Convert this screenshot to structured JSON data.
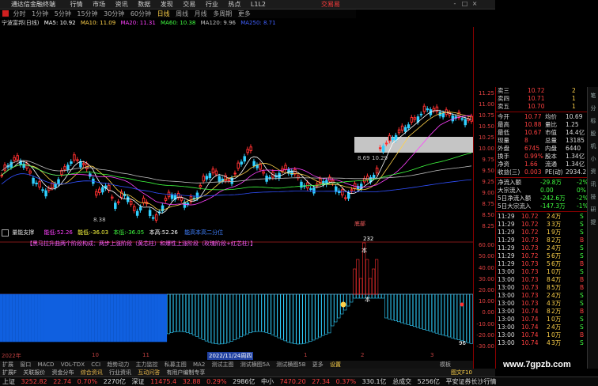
{
  "app": {
    "title": "通达信金融终端",
    "menu": [
      "行情",
      "市场",
      "资讯",
      "数据",
      "发现",
      "交易",
      "行业",
      "热点",
      "L1L2"
    ],
    "broker": "交易易",
    "window_buttons": [
      "-",
      "□",
      "×"
    ]
  },
  "periods": [
    "分时",
    "1分钟",
    "5分钟",
    "15分钟",
    "30分钟",
    "60分钟",
    "日线",
    "周线",
    "月线",
    "多周期",
    "更多"
  ],
  "active_period": "日线",
  "ma_legend": {
    "stock": "宁波富邦(日线)",
    "items": [
      {
        "label": "MA5: 10.92",
        "color": "#ffffff"
      },
      {
        "label": "MA10: 11.09",
        "color": "#ffd24a"
      },
      {
        "label": "MA20: 11.31",
        "color": "#ff40ff"
      },
      {
        "label": "MA60: 10.38",
        "color": "#40ff40"
      },
      {
        "label": "MA120: 9.96",
        "color": "#c0c0c0"
      },
      {
        "label": "MA250: 8.71",
        "color": "#4060ff"
      }
    ]
  },
  "chart_labels": {
    "low_mark": "8.38",
    "mid_mark": "8.69",
    "mid_mark2": "10.29",
    "ind_badge": "232",
    "ind_ben1": "本",
    "ind_ben2": "本",
    "ind_low": "96",
    "bottom_label": "底部"
  },
  "price_axis": [
    "11.25",
    "11.00",
    "10.75",
    "10.50",
    "10.25",
    "10.00",
    "9.75",
    "9.50",
    "9.25",
    "9.00",
    "8.75",
    "8.50",
    "8.25"
  ],
  "ind_axis": [
    "60.00",
    "50.00",
    "40.00",
    "30.00",
    "20.00",
    "10.00",
    "0.00",
    "-10.00",
    "-20.00",
    "-30.00"
  ],
  "indicator": {
    "name": "量能支撑",
    "values": [
      {
        "label": "能低:52.26",
        "color": "#ff40ff"
      },
      {
        "label": "能低:-36.03",
        "color": "#ffff40"
      },
      {
        "label": "本低:-36.05",
        "color": "#40ff40"
      },
      {
        "label": "本高:52.26",
        "color": "#ffffff"
      },
      {
        "label": "能高本高二分位",
        "color": "#4080ff"
      }
    ],
    "banner": "【黑马拉升曲两个阶段构成：两步上涨阶段（黄芯柱）和爆性上涨阶段（玫瑰阶段+红芯柱）】"
  },
  "dates": {
    "d1": "2022年",
    "d2": "10",
    "d3": "11",
    "d4": "2022/11/24周四",
    "d5": "1",
    "d6": "2",
    "d7": "3"
  },
  "tabs": [
    "扩展",
    "窗口",
    "MACD",
    "VOL-TDX",
    "CCI",
    "趋势动力",
    "主力监控",
    "私募主图",
    "MA2",
    "测试主图",
    "测试横图5A",
    "测试横图5B",
    "更多",
    "设置"
  ],
  "tabs_right": "模板",
  "func_tabs": [
    "扩展F",
    "关联报价",
    "资金分布",
    "综合资讯",
    "行业资讯",
    "互动问答",
    "有用户编制专享"
  ],
  "func_tabs_right": "图文F10",
  "quote": {
    "sell": [
      {
        "label": "卖三",
        "price": "10.72",
        "vol": "2"
      },
      {
        "label": "卖四",
        "price": "10.71",
        "vol": "1"
      },
      {
        "label": "卖五",
        "price": "10.70",
        "vol": "1"
      }
    ],
    "stats": [
      {
        "a": "今开",
        "av": "10.77",
        "b": "均价",
        "bv": "10.69"
      },
      {
        "a": "最高",
        "av": "10.88",
        "b": "量比",
        "bv": "1.25"
      },
      {
        "a": "最低",
        "av": "10.67",
        "b": "市值",
        "bv": "14.4亿"
      },
      {
        "a": "现量",
        "av": "8",
        "b": "总量",
        "bv": "13185"
      },
      {
        "a": "外盘",
        "av": "6745",
        "b": "内盘",
        "bv": "6440"
      },
      {
        "a": "换手",
        "av": "0.99%",
        "b": "股本",
        "bv": "1.34亿"
      },
      {
        "a": "净资",
        "av": "1.66",
        "b": "流通",
        "bv": "1.34亿"
      },
      {
        "a": "收益(三)",
        "av": "0.003",
        "b": "PE(动)",
        "bv": "2934.2"
      }
    ],
    "flows": [
      {
        "label": "净流入额",
        "value": "-29.8万",
        "pct": "-2%"
      },
      {
        "label": "大宗流入",
        "value": "0.00",
        "pct": "0%"
      },
      {
        "label": "5日净流入额",
        "value": "-242.6万",
        "pct": "-2%"
      },
      {
        "label": "5日大宗流入",
        "value": "-147.3万",
        "pct": "-1%"
      }
    ],
    "ticks": [
      {
        "t": "11:29",
        "p": "10.72",
        "v": "2",
        "u": "4万",
        "s": "S"
      },
      {
        "t": "11:29",
        "p": "10.72",
        "v": "3",
        "u": "3万",
        "s": "S"
      },
      {
        "t": "11:29",
        "p": "10.72",
        "v": "1",
        "u": "9万",
        "s": "S"
      },
      {
        "t": "11:29",
        "p": "10.73",
        "v": "8",
        "u": "2万",
        "s": "B"
      },
      {
        "t": "11:29",
        "p": "10.73",
        "v": "2",
        "u": "4万",
        "s": "S"
      },
      {
        "t": "11:29",
        "p": "10.72",
        "v": "5",
        "u": "6万",
        "s": "S"
      },
      {
        "t": "11:29",
        "p": "10.73",
        "v": "5",
        "u": "6万",
        "s": "B"
      },
      {
        "t": "13:00",
        "p": "10.73",
        "v": "1",
        "u": "0万",
        "s": "S"
      },
      {
        "t": "13:00",
        "p": "10.73",
        "v": "8",
        "u": "4万",
        "s": "B"
      },
      {
        "t": "13:00",
        "p": "10.73",
        "v": "8",
        "u": "5万",
        "s": "B"
      },
      {
        "t": "13:00",
        "p": "10.73",
        "v": "2",
        "u": "4万",
        "s": "S"
      },
      {
        "t": "13:00",
        "p": "10.73",
        "v": "4",
        "u": "3万",
        "s": "S"
      },
      {
        "t": "13:00",
        "p": "10.74",
        "v": "8",
        "u": "2万",
        "s": "B"
      },
      {
        "t": "13:00",
        "p": "10.74",
        "v": "1",
        "u": "0万",
        "s": "S"
      },
      {
        "t": "13:00",
        "p": "10.74",
        "v": "2",
        "u": "4万",
        "s": "S"
      },
      {
        "t": "13:00",
        "p": "10.74",
        "v": "1",
        "u": "0万",
        "s": "B"
      },
      {
        "t": "13:00",
        "p": "10.74",
        "v": "4",
        "u": "3万",
        "s": "S"
      }
    ]
  },
  "status": {
    "sh_name": "上证",
    "sh_val": "3252.82",
    "sh_chg": "22.74",
    "sh_pct": "0.70%",
    "sh_amt": "2270亿",
    "sz_name": "深证",
    "sz_val": "11475.4",
    "sz_chg": "32.88",
    "sz_pct": "0.29%",
    "sz_amt": "2986亿",
    "zx_name": "中小",
    "zx_val": "7470.20",
    "zx_chg": "27.34",
    "zx_pct": "0.37%",
    "zx_amt": "330.1亿",
    "total_label": "总成交",
    "total_amt": "5256亿",
    "conn": "平安证券长沙行情"
  },
  "scrollbar_labels": [
    "笔",
    "分",
    "标",
    "股",
    "机",
    "小",
    "资",
    "讯",
    "技",
    "研",
    "提"
  ],
  "watermark": "www.7gpzb.com",
  "colors": {
    "up": "#ff3030",
    "down": "#30d0ff",
    "ma5": "#ffffff",
    "ma10": "#ffd24a",
    "ma20": "#ff40ff",
    "ma60": "#40ff40",
    "ma120": "#c0c0c0",
    "ma250": "#3050ff",
    "axis": "#e04040"
  }
}
